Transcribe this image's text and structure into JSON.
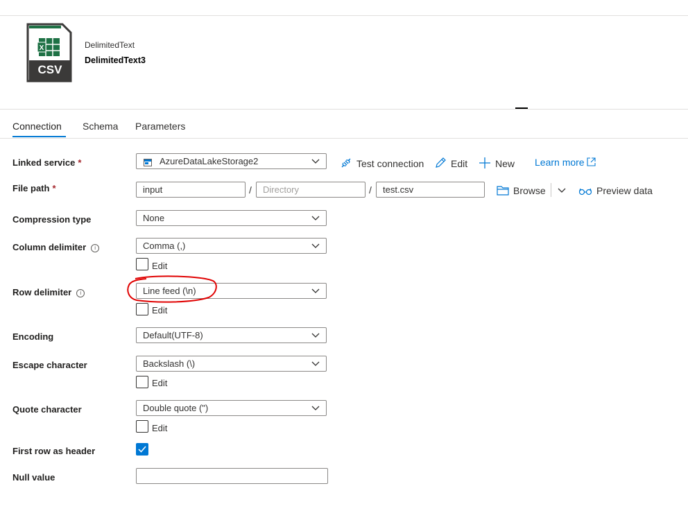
{
  "header": {
    "icon_text": "CSV",
    "dataset_type": "DelimitedText",
    "dataset_name": "DelimitedText3"
  },
  "tabs": [
    {
      "label": "Connection",
      "active": true
    },
    {
      "label": "Schema",
      "active": false
    },
    {
      "label": "Parameters",
      "active": false
    }
  ],
  "linked_service": {
    "label": "Linked service",
    "required_mark": "*",
    "value": "AzureDataLakeStorage2",
    "icon": "storage-icon"
  },
  "actions": {
    "test_connection": "Test connection",
    "edit": "Edit",
    "new": "New",
    "learn_more": "Learn more",
    "browse": "Browse",
    "preview_data": "Preview data"
  },
  "file_path": {
    "label": "File path",
    "required_mark": "*",
    "container": "input",
    "directory_placeholder": "Directory",
    "directory_value": "",
    "file": "test.csv",
    "separator": "/"
  },
  "compression_type": {
    "label": "Compression type",
    "value": "None"
  },
  "column_delimiter": {
    "label": "Column delimiter",
    "info": "i",
    "value": "Comma (,)",
    "edit_label": "Edit",
    "edit_checked": false
  },
  "row_delimiter": {
    "label": "Row delimiter",
    "info": "i",
    "value": "Line feed (\\n)",
    "edit_label": "Edit",
    "edit_checked": false
  },
  "encoding": {
    "label": "Encoding",
    "value": "Default(UTF-8)"
  },
  "escape_character": {
    "label": "Escape character",
    "value": "Backslash (\\)",
    "edit_label": "Edit",
    "edit_checked": false
  },
  "quote_character": {
    "label": "Quote character",
    "value": "Double quote (\")",
    "edit_label": "Edit",
    "edit_checked": false
  },
  "first_row_as_header": {
    "label": "First row as header",
    "checked": true
  },
  "null_value": {
    "label": "Null value",
    "value": ""
  },
  "colors": {
    "accent": "#0078d4",
    "required": "#a4262c",
    "annotation": "#e00000"
  }
}
